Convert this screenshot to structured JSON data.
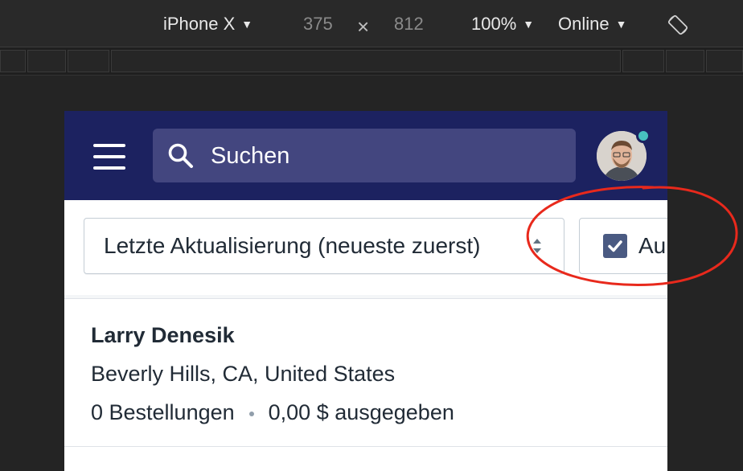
{
  "devtools": {
    "device": "iPhone X",
    "width": "375",
    "times": "×",
    "height": "812",
    "zoom": "100%",
    "network": "Online"
  },
  "app": {
    "search": {
      "placeholder": "Suchen"
    },
    "sort": {
      "label": "Letzte Aktualisierung (neueste zuerst)"
    },
    "filter_checkbox": {
      "label": "Au",
      "checked": true
    },
    "customer": {
      "name": "Larry Denesik",
      "location": "Beverly Hills, CA, United States",
      "orders": "0 Bestellungen",
      "spent": "0,00 $ ausgegeben"
    }
  },
  "colors": {
    "topbar": "#1c2260",
    "search_bg": "#43467f",
    "notification_dot": "#47c1bf",
    "annotation": "#e8291c"
  }
}
